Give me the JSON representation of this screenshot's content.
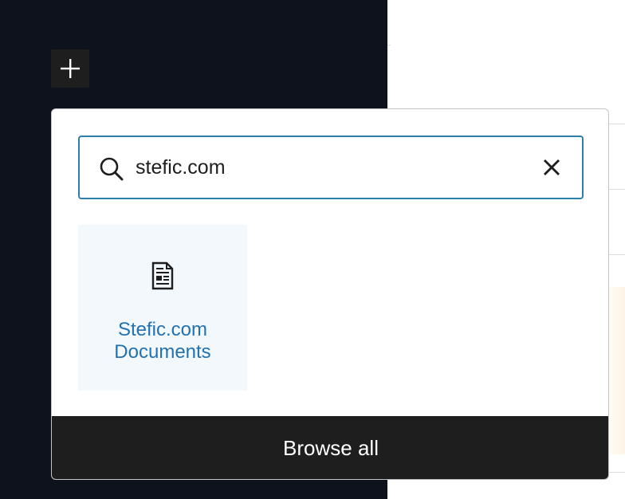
{
  "toolbar": {
    "add_block_icon": "plus-icon"
  },
  "inserter": {
    "search": {
      "value": "stefic.com",
      "icon": "search-icon",
      "clear_icon": "close-icon"
    },
    "results": [
      {
        "label": "Stefic.com Documents",
        "icon": "document-icon"
      }
    ],
    "browse_all_label": "Browse all"
  },
  "colors": {
    "dark_panel": "#0e121d",
    "accent": "#2271b1",
    "focus_border": "#2c7fa8",
    "button_dark": "#1e1e1e"
  }
}
